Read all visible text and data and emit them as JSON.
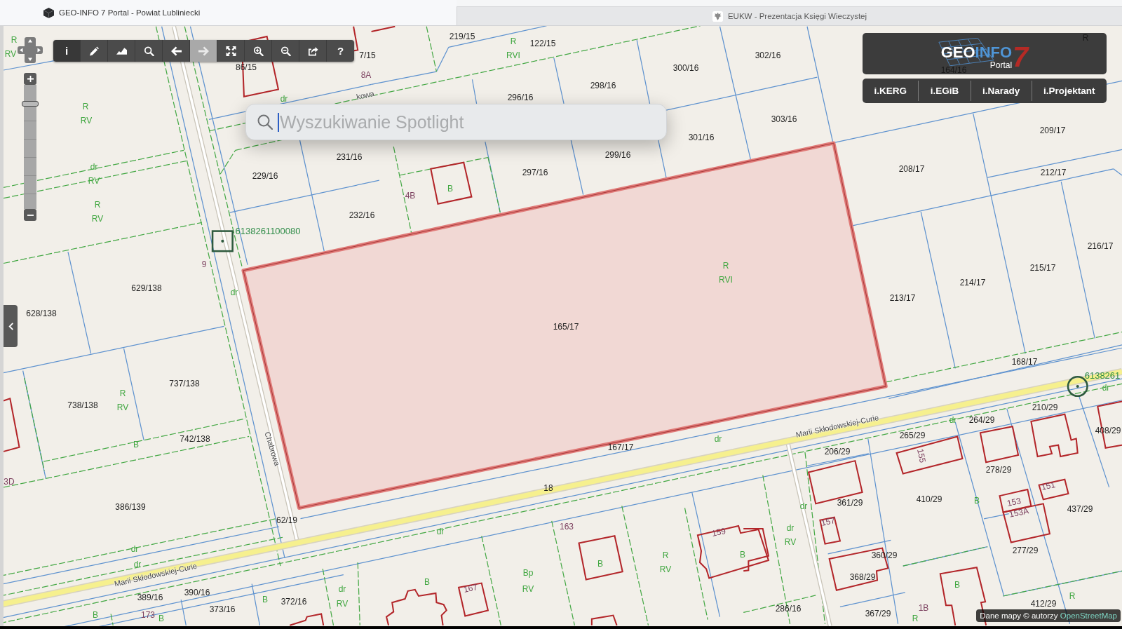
{
  "browser_tabs": [
    {
      "title": "GEO-INFO 7 Portal - Powiat Lubliniecki",
      "selected": true
    },
    {
      "title": "EUKW - Prezentacja Księgi Wieczystej",
      "selected": false
    }
  ],
  "toolbar": {
    "tools": [
      {
        "kind": "info",
        "label": "i",
        "selected": true,
        "disabled": false
      },
      {
        "kind": "draw",
        "selected": false,
        "disabled": false
      },
      {
        "kind": "profile",
        "selected": false,
        "disabled": false
      },
      {
        "kind": "search",
        "selected": false,
        "disabled": false
      },
      {
        "kind": "back",
        "selected": false,
        "disabled": false
      },
      {
        "kind": "forward",
        "selected": false,
        "disabled": true
      },
      {
        "kind": "extent",
        "selected": false,
        "disabled": false
      },
      {
        "kind": "zoom_in",
        "selected": false,
        "disabled": false
      },
      {
        "kind": "zoom_out",
        "selected": false,
        "disabled": false
      },
      {
        "kind": "export",
        "selected": false,
        "disabled": false
      },
      {
        "kind": "help",
        "label": "?",
        "selected": false,
        "disabled": false
      }
    ]
  },
  "zoom_slider": {
    "level": 0.85
  },
  "search": {
    "placeholder": "Wyszukiwanie Spotlight",
    "focused": true
  },
  "logo": {
    "title_parts": [
      "GEO",
      "INFO"
    ],
    "version": "7",
    "subtitle": "Portal"
  },
  "portal_menu": [
    "i.KERG",
    "i.EGiB",
    "i.Narady",
    "i.Projektant"
  ],
  "map": {
    "labels": [
      {
        "text": "219/15",
        "kind": "parcel"
      },
      {
        "text": "R",
        "kind": "land_use"
      },
      {
        "text": "R",
        "kind": "faded"
      },
      {
        "text": "R",
        "kind": "land_use"
      },
      {
        "text": "122/15",
        "kind": "parcel"
      },
      {
        "text": "RV",
        "kind": "land_use"
      },
      {
        "text": "7/15",
        "kind": "parcel"
      },
      {
        "text": "RVI",
        "kind": "land_use"
      },
      {
        "text": "302/16",
        "kind": "parcel"
      },
      {
        "text": "86/15",
        "kind": "parcel"
      },
      {
        "text": "300/16",
        "kind": "parcel"
      },
      {
        "text": "164/16",
        "kind": "faded"
      },
      {
        "text": "8A",
        "kind": "building_number"
      },
      {
        "text": "298/16",
        "kind": "parcel"
      },
      {
        "text": "kowa",
        "kind": "street"
      },
      {
        "text": "dr",
        "kind": "land_use"
      },
      {
        "text": "296/16",
        "kind": "parcel"
      },
      {
        "text": "R",
        "kind": "land_use"
      },
      {
        "text": "RV",
        "kind": "land_use"
      },
      {
        "text": "303/16",
        "kind": "parcel"
      },
      {
        "text": "209/17",
        "kind": "parcel"
      },
      {
        "text": "301/16",
        "kind": "parcel"
      },
      {
        "text": "231/16",
        "kind": "parcel"
      },
      {
        "text": "299/16",
        "kind": "parcel"
      },
      {
        "text": "dr",
        "kind": "land_use"
      },
      {
        "text": "208/17",
        "kind": "parcel"
      },
      {
        "text": "297/16",
        "kind": "parcel"
      },
      {
        "text": "212/17",
        "kind": "parcel"
      },
      {
        "text": "229/16",
        "kind": "parcel"
      },
      {
        "text": "RV",
        "kind": "land_use"
      },
      {
        "text": "B",
        "kind": "land_use"
      },
      {
        "text": "4B",
        "kind": "building_number"
      },
      {
        "text": "R",
        "kind": "land_use"
      },
      {
        "text": "232/16",
        "kind": "parcel"
      },
      {
        "text": "RV",
        "kind": "land_use"
      },
      {
        "text": "6138261100080",
        "kind": "point_id"
      },
      {
        "text": "216/17",
        "kind": "parcel"
      },
      {
        "text": "9",
        "kind": "building_number"
      },
      {
        "text": "R",
        "kind": "land_use"
      },
      {
        "text": "215/17",
        "kind": "parcel"
      },
      {
        "text": "RVI",
        "kind": "land_use"
      },
      {
        "text": "214/17",
        "kind": "parcel"
      },
      {
        "text": "629/138",
        "kind": "parcel"
      },
      {
        "text": "dr",
        "kind": "land_use"
      },
      {
        "text": "213/17",
        "kind": "parcel"
      },
      {
        "text": "628/138",
        "kind": "parcel"
      },
      {
        "text": "165/17",
        "kind": "parcel"
      },
      {
        "text": "168/17",
        "kind": "parcel"
      },
      {
        "text": "6138261",
        "kind": "point_id"
      },
      {
        "text": "737/138",
        "kind": "parcel"
      },
      {
        "text": "dr",
        "kind": "land_use"
      },
      {
        "text": "R",
        "kind": "land_use"
      },
      {
        "text": "738/138",
        "kind": "parcel"
      },
      {
        "text": "RV",
        "kind": "land_use"
      },
      {
        "text": "210/29",
        "kind": "parcel"
      },
      {
        "text": "dr",
        "kind": "land_use"
      },
      {
        "text": "264/29",
        "kind": "parcel"
      },
      {
        "text": "Marii Skłodowskiej-Curie",
        "kind": "street"
      },
      {
        "text": "408/29",
        "kind": "parcel"
      },
      {
        "text": "265/29",
        "kind": "parcel"
      },
      {
        "text": "742/138",
        "kind": "parcel"
      },
      {
        "text": "dr",
        "kind": "land_use"
      },
      {
        "text": "B",
        "kind": "land_use"
      },
      {
        "text": "Chabrowa",
        "kind": "street"
      },
      {
        "text": "167/17",
        "kind": "parcel"
      },
      {
        "text": "206/29",
        "kind": "parcel"
      },
      {
        "text": "155",
        "kind": "building_number"
      },
      {
        "text": "278/29",
        "kind": "parcel"
      },
      {
        "text": "3D",
        "kind": "building_number"
      },
      {
        "text": "18",
        "kind": "parcel"
      },
      {
        "text": "151",
        "kind": "building_number"
      },
      {
        "text": "410/29",
        "kind": "parcel"
      },
      {
        "text": "361/29",
        "kind": "parcel"
      },
      {
        "text": "B",
        "kind": "land_use"
      },
      {
        "text": "153",
        "kind": "building_number"
      },
      {
        "text": "386/139",
        "kind": "parcel"
      },
      {
        "text": "dr",
        "kind": "land_use"
      },
      {
        "text": "437/29",
        "kind": "parcel"
      },
      {
        "text": "153A",
        "kind": "building_number"
      },
      {
        "text": "62/19",
        "kind": "parcel"
      },
      {
        "text": "157",
        "kind": "building_number"
      },
      {
        "text": "163",
        "kind": "building_number"
      },
      {
        "text": "dr",
        "kind": "land_use"
      },
      {
        "text": "dr",
        "kind": "land_use"
      },
      {
        "text": "159",
        "kind": "building_number"
      },
      {
        "text": "RV",
        "kind": "land_use"
      },
      {
        "text": "dr",
        "kind": "land_use"
      },
      {
        "text": "277/29",
        "kind": "parcel"
      },
      {
        "text": "R",
        "kind": "land_use"
      },
      {
        "text": "B",
        "kind": "land_use"
      },
      {
        "text": "360/29",
        "kind": "parcel"
      },
      {
        "text": "dr",
        "kind": "land_use"
      },
      {
        "text": "B",
        "kind": "land_use"
      },
      {
        "text": "RV",
        "kind": "land_use"
      },
      {
        "text": "Marii Skłodowskiej-Curie",
        "kind": "street"
      },
      {
        "text": "Bp",
        "kind": "land_use"
      },
      {
        "text": "368/29",
        "kind": "parcel"
      },
      {
        "text": "B",
        "kind": "land_use"
      },
      {
        "text": "B",
        "kind": "land_use"
      },
      {
        "text": "dr",
        "kind": "land_use"
      },
      {
        "text": "167",
        "kind": "building_number"
      },
      {
        "text": "RV",
        "kind": "land_use"
      },
      {
        "text": "390/16",
        "kind": "parcel"
      },
      {
        "text": "389/16",
        "kind": "parcel"
      },
      {
        "text": "R",
        "kind": "land_use"
      },
      {
        "text": "B",
        "kind": "land_use"
      },
      {
        "text": "372/16",
        "kind": "parcel"
      },
      {
        "text": "RV",
        "kind": "land_use"
      },
      {
        "text": "412/29",
        "kind": "parcel"
      },
      {
        "text": "373/16",
        "kind": "parcel"
      },
      {
        "text": "286/16",
        "kind": "parcel"
      },
      {
        "text": "1B",
        "kind": "building_number"
      },
      {
        "text": "B",
        "kind": "land_use"
      },
      {
        "text": "173",
        "kind": "building_number"
      },
      {
        "text": "367/29",
        "kind": "parcel"
      },
      {
        "text": "B",
        "kind": "land_use"
      },
      {
        "text": "R",
        "kind": "land_use"
      }
    ]
  },
  "attribution": {
    "text": "Dane mapy © autorzy",
    "link": "OpenStreetMap"
  }
}
